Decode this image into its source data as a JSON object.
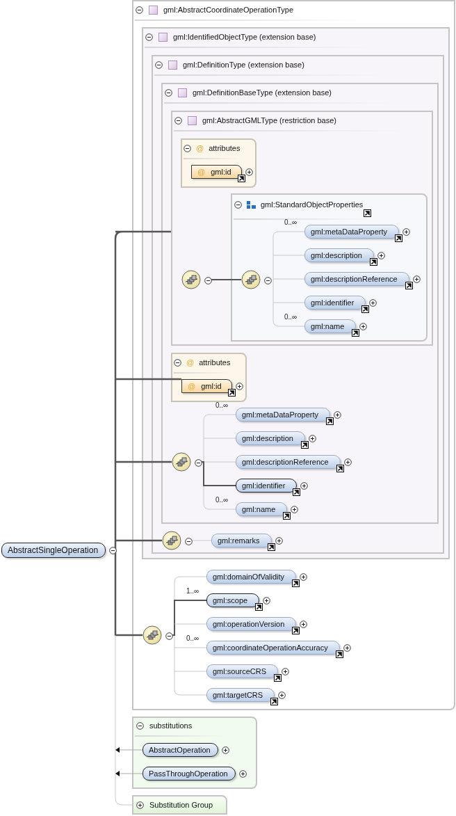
{
  "root": {
    "name": "AbstractSingleOperation",
    "expanded": true
  },
  "type_boxes": [
    {
      "label": "gml:AbstractCoordinateOperationType",
      "expanded": true
    },
    {
      "label": "gml:IdentifiedObjectType (extension base)",
      "expanded": true
    },
    {
      "label": "gml:DefinitionType (extension base)",
      "expanded": true
    },
    {
      "label": "gml:DefinitionBaseType (extension base)",
      "expanded": true
    },
    {
      "label": "gml:AbstractGMLType (restriction base)",
      "expanded": true
    }
  ],
  "attribute_groups": [
    {
      "symbol": "@",
      "title": "attributes",
      "expanded": true,
      "attributes": [
        {
          "symbol": "@",
          "name": "gml:id",
          "expanded": false
        }
      ]
    },
    {
      "symbol": "@",
      "title": "attributes",
      "expanded": true,
      "attributes": [
        {
          "symbol": "@",
          "name": "gml:id",
          "expanded": false
        }
      ]
    }
  ],
  "standard_properties": {
    "name": "gml:StandardObjectProperties",
    "expanded": true,
    "sequence": {
      "expanded": true,
      "elements": [
        {
          "name": "gml:metaDataProperty",
          "occurs": "0..∞",
          "required": false,
          "expanded": false
        },
        {
          "name": "gml:description",
          "required": false,
          "expanded": false
        },
        {
          "name": "gml:descriptionReference",
          "required": false,
          "expanded": false
        },
        {
          "name": "gml:identifier",
          "required": false,
          "expanded": false
        },
        {
          "name": "gml:name",
          "occurs": "0..∞",
          "required": false,
          "expanded": false
        }
      ]
    }
  },
  "sequences": [
    {
      "expanded": true
    },
    {
      "expanded": true,
      "elements": [
        {
          "name": "gml:metaDataProperty",
          "occurs": "0..∞",
          "required": false,
          "expanded": false
        },
        {
          "name": "gml:description",
          "required": false,
          "expanded": false
        },
        {
          "name": "gml:descriptionReference",
          "required": false,
          "expanded": false
        },
        {
          "name": "gml:identifier",
          "required": true,
          "expanded": false
        },
        {
          "name": "gml:name",
          "occurs": "0..∞",
          "required": false,
          "expanded": false
        }
      ]
    },
    {
      "expanded": true,
      "elements": [
        {
          "name": "gml:remarks",
          "required": false,
          "expanded": false
        }
      ]
    },
    {
      "expanded": true,
      "elements": [
        {
          "name": "gml:domainOfValidity",
          "required": false,
          "expanded": false
        },
        {
          "name": "gml:scope",
          "occurs": "1..∞",
          "required": true,
          "expanded": false
        },
        {
          "name": "gml:operationVersion",
          "required": false,
          "expanded": false
        },
        {
          "name": "gml:coordinateOperationAccuracy",
          "occurs": "0..∞",
          "required": false,
          "expanded": false
        },
        {
          "name": "gml:sourceCRS",
          "required": false,
          "expanded": false
        },
        {
          "name": "gml:targetCRS",
          "required": false,
          "expanded": false
        }
      ]
    }
  ],
  "substitutions": {
    "title": "substitutions",
    "expanded": true,
    "items": [
      {
        "name": "AbstractOperation",
        "expanded": false
      },
      {
        "name": "PassThroughOperation",
        "expanded": false
      }
    ]
  },
  "substitution_group": {
    "title": "Substitution Group",
    "expanded": false
  }
}
